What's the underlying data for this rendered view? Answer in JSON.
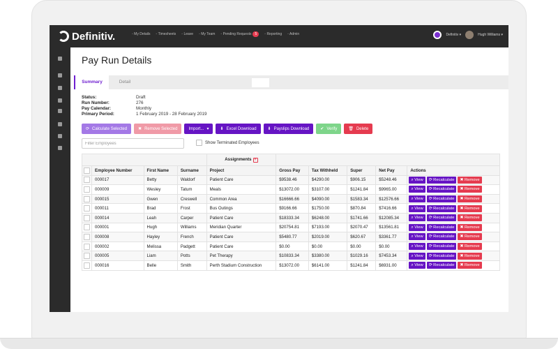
{
  "app": {
    "logo_text": "Definitiv.",
    "nav": [
      {
        "icon": "user-icon",
        "label": "My Details"
      },
      {
        "icon": "clock-icon",
        "label": "Timesheets"
      },
      {
        "icon": "leave-icon",
        "label": "Leave"
      },
      {
        "icon": "team-icon",
        "label": "My Team"
      },
      {
        "icon": "check-icon",
        "label": "Pending Requests",
        "badge": "5"
      },
      {
        "icon": "chart-icon",
        "label": "Reporting"
      },
      {
        "icon": "gear-icon",
        "label": "Admin"
      }
    ],
    "org": "Definitiv",
    "user": "Hugh Williams"
  },
  "page": {
    "title": "Pay Run Details",
    "tabs": [
      "Summary",
      "Detail"
    ],
    "info": [
      {
        "label": "Status:",
        "value": "Draft"
      },
      {
        "label": "Run Number:",
        "value": "276"
      },
      {
        "label": "Pay Calendar:",
        "value": "Monthly"
      },
      {
        "label": "Primary Period:",
        "value": "1 February 2019 - 28 February 2019"
      }
    ],
    "buttons": {
      "calculate": "Calculate Selected",
      "remove_selected": "Remove Selected",
      "import": "Import...",
      "excel": "Excel Download",
      "payslips": "Payslips Download",
      "verify": "Verify",
      "delete": "Delete"
    },
    "filter_placeholder": "Filter Employees",
    "show_terminated": "Show Terminated Employees"
  },
  "table": {
    "group_header": "Assignments",
    "columns": [
      "Employee Number",
      "First Name",
      "Surname",
      "Project",
      "Gross Pay",
      "Tax Withheld",
      "Super",
      "Net Pay",
      "Actions"
    ],
    "row_actions": {
      "view": "View",
      "recalc": "Recalculate",
      "remove": "Remove"
    },
    "rows": [
      [
        "000017",
        "Betty",
        "Waldorf",
        "Patient Care",
        "$9538.46",
        "$4290.00",
        "$906.15",
        "$5248.46"
      ],
      [
        "000009",
        "Wesley",
        "Tatum",
        "Meals",
        "$13072.00",
        "$3107.00",
        "$1241.84",
        "$9965.00"
      ],
      [
        "000015",
        "Gwen",
        "Creswell",
        "Common Area",
        "$16666.66",
        "$4090.00",
        "$1583.34",
        "$12576.66"
      ],
      [
        "000011",
        "Brad",
        "Frost",
        "Bus Outings",
        "$9166.66",
        "$1750.00",
        "$870.84",
        "$7416.66"
      ],
      [
        "000014",
        "Leah",
        "Carper",
        "Patient Care",
        "$18333.34",
        "$6248.00",
        "$1741.66",
        "$12085.34"
      ],
      [
        "000001",
        "Hugh",
        "Williams",
        "Meridian Quarter",
        "$20754.81",
        "$7193.00",
        "$2070.47",
        "$13561.81"
      ],
      [
        "000008",
        "Hayley",
        "French",
        "Patient Care",
        "$5480.77",
        "$2019.00",
        "$620.67",
        "$3361.77"
      ],
      [
        "000002",
        "Melissa",
        "Padgett",
        "Patient Care",
        "$0.00",
        "$0.00",
        "$0.00",
        "$0.00"
      ],
      [
        "000005",
        "Liam",
        "Potts",
        "Pet Therapy",
        "$10833.34",
        "$3380.00",
        "$1029.16",
        "$7453.34"
      ],
      [
        "000016",
        "Belle",
        "Smith",
        "Perth Stadium Construction",
        "$13072.00",
        "$6141.00",
        "$1241.84",
        "$6931.00"
      ]
    ]
  },
  "colors": {
    "primary": "#6614c4",
    "danger": "#e53b4f",
    "success": "#7ed58a",
    "topbar": "#2b2b2b"
  }
}
